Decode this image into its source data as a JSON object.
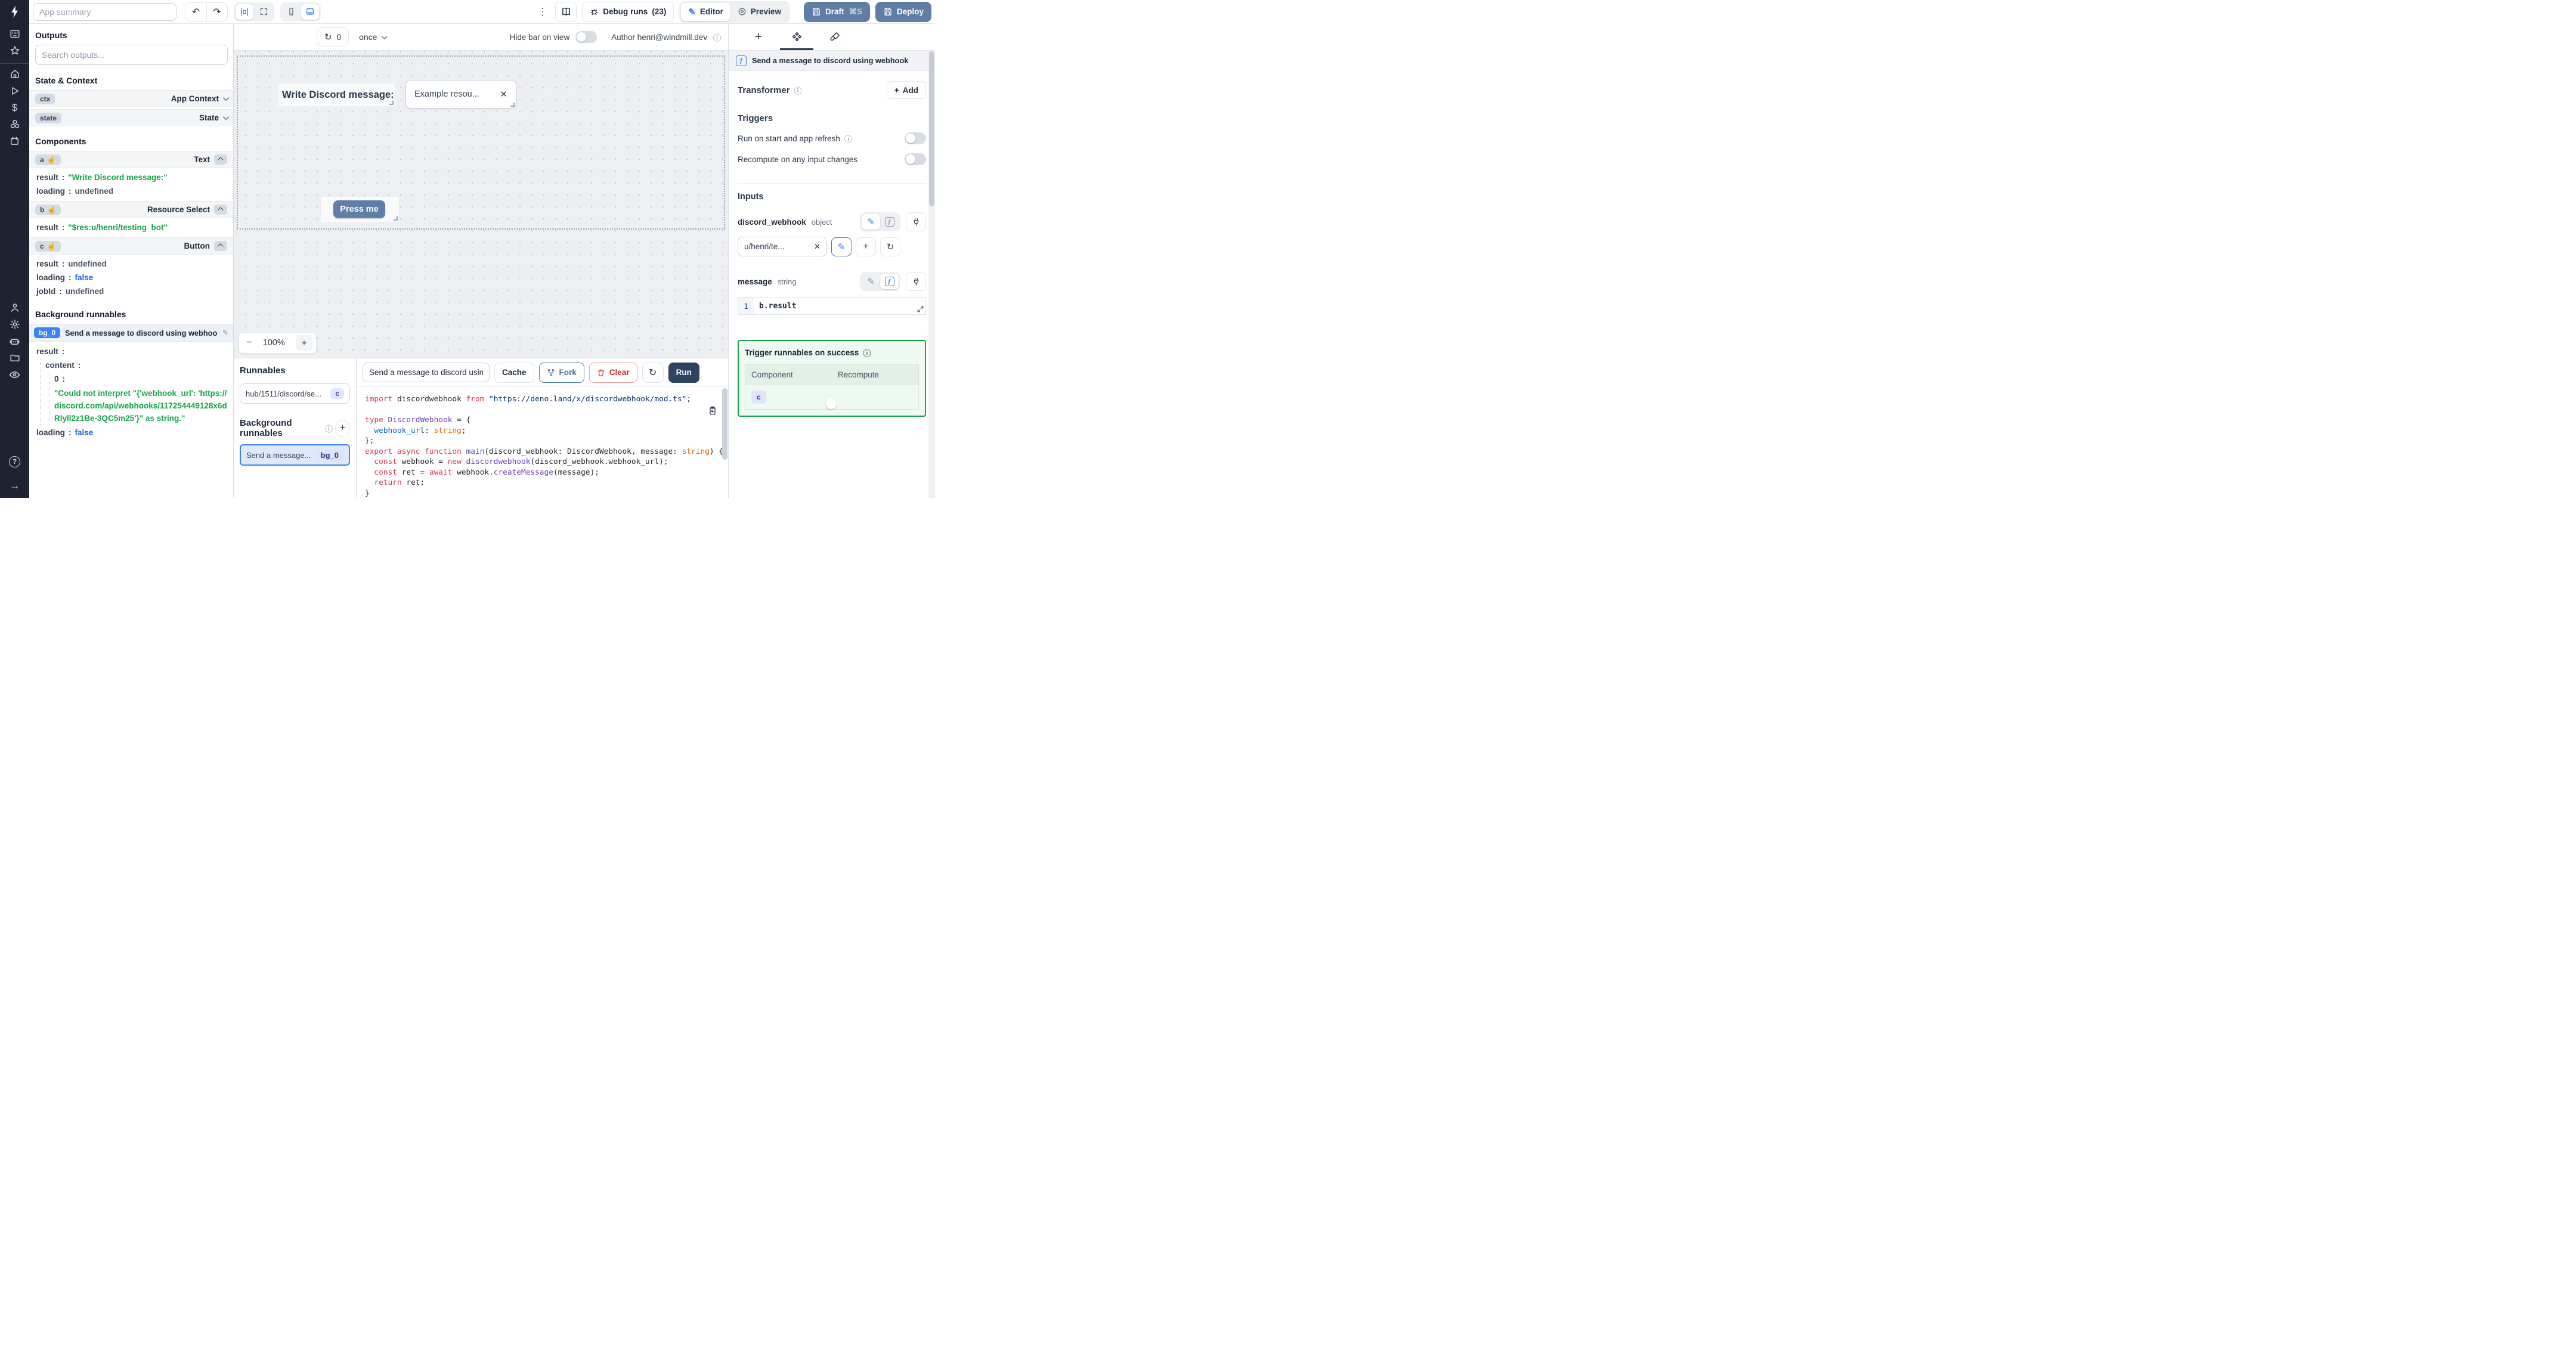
{
  "colors": {
    "accent_blue": "#3b82f6",
    "slate_button": "#5f7da5",
    "run_button": "#2e4262",
    "toggle_on": "#2f6cf0",
    "success_border": "#1d9f4e",
    "value_green": "#16a34a",
    "value_blue": "#2563eb",
    "rail_bg": "#1d2330"
  },
  "icons": {
    "undo": "↶",
    "redo": "↷",
    "kebab": "⋮",
    "refresh": "↻",
    "info": "ⓘ",
    "close": "✕",
    "plus": "+",
    "minus": "−",
    "pencil": "✎",
    "hand": "☝",
    "fn": "f",
    "question": "?",
    "arrow_right": "→",
    "dollar": "$"
  },
  "topbar": {
    "app_summary_placeholder": "App summary",
    "debug_runs_label": "Debug runs",
    "debug_runs_count": "(23)",
    "editor_label": "Editor",
    "preview_label": "Preview",
    "draft_label": "Draft",
    "draft_shortcut": "⌘S",
    "deploy_label": "Deploy"
  },
  "canvas_toolbar": {
    "refresh_count": "0",
    "frequency": "once",
    "hide_bar_label": "Hide bar on view",
    "author_label": "Author henri@windmill.dev"
  },
  "canvas": {
    "text_component": "Write Discord message:",
    "select_value": "Example resou...",
    "button_label": "Press me",
    "zoom_level": "100%"
  },
  "outputs": {
    "title": "Outputs",
    "search_placeholder": "Search outputs...",
    "sep": ":",
    "state_title": "State & Context",
    "ctx_badge": "ctx",
    "ctx_label": "App Context",
    "state_badge": "state",
    "state_label": "State",
    "components_title": "Components",
    "a_badge": "a",
    "a_type": "Text",
    "a_result_key": "result",
    "a_result_val": "\"Write Discord message:\"",
    "a_loading_key": "loading",
    "a_loading_val": "undefined",
    "b_badge": "b",
    "b_type": "Resource Select",
    "b_result_key": "result",
    "b_result_val": "\"$res:u/henri/testing_bot\"",
    "c_badge": "c",
    "c_type": "Button",
    "c_result_key": "result",
    "c_result_val": "undefined",
    "c_loading_key": "loading",
    "c_loading_val": "false",
    "c_jobid_key": "jobId",
    "c_jobid_val": "undefined",
    "bg_title": "Background runnables",
    "bg_badge": "bg_0",
    "bg_label": "Send a message to discord using webhook",
    "bg_result_key": "result",
    "bg_content_key": "content",
    "bg_index_key": "0",
    "bg_error": "\"Could not interpret \"{'webhook_url': 'https://discord.com/api/webhooks/117254449128x6dRlyll2z1Be-3QC5m25'}\" as string.\"",
    "bg_loading_key": "loading",
    "bg_loading_val": "false"
  },
  "runnables": {
    "title": "Runnables",
    "script_label": "hub/1511/discord/se...",
    "script_badge": "c",
    "bg_title": "Background runnables",
    "bg_label": "Send a message...",
    "bg_badge": "bg_0"
  },
  "editor": {
    "name_value": "Send a message to discord using",
    "cache_label": "Cache",
    "fork_label": "Fork",
    "clear_label": "Clear",
    "run_label": "Run",
    "code_lines": [
      [
        [
          "kw",
          "import "
        ],
        [
          "pl",
          "discordwebhook "
        ],
        [
          "kw",
          "from "
        ],
        [
          "st",
          "\"https://deno.land/x/discordwebhook/mod.ts\""
        ],
        [
          "pl",
          ";"
        ]
      ],
      [
        [
          "pl",
          ""
        ]
      ],
      [
        [
          "kw",
          "type "
        ],
        [
          "ty",
          "DiscordWebhook"
        ],
        [
          "pl",
          " = {"
        ]
      ],
      [
        [
          "pl",
          "  "
        ],
        [
          "pr",
          "webhook_url"
        ],
        [
          "pl",
          ": "
        ],
        [
          "or",
          "string"
        ],
        [
          "pl",
          ";"
        ]
      ],
      [
        [
          "pl",
          "};"
        ]
      ],
      [
        [
          "kw",
          "export async function "
        ],
        [
          "fn",
          "main"
        ],
        [
          "pl",
          "(discord_webhook: DiscordWebhook, message: "
        ],
        [
          "or",
          "string"
        ],
        [
          "pl",
          ") {"
        ]
      ],
      [
        [
          "pl",
          "  "
        ],
        [
          "kw",
          "const"
        ],
        [
          "pl",
          " webhook = "
        ],
        [
          "kw",
          "new"
        ],
        [
          "pl",
          " "
        ],
        [
          "ty",
          "discordwebhook"
        ],
        [
          "pl",
          "(discord_webhook.webhook_url);"
        ]
      ],
      [
        [
          "pl",
          "  "
        ],
        [
          "kw",
          "const"
        ],
        [
          "pl",
          " ret = "
        ],
        [
          "kw",
          "await"
        ],
        [
          "pl",
          " webhook."
        ],
        [
          "ty",
          "createMessage"
        ],
        [
          "pl",
          "(message);"
        ]
      ],
      [
        [
          "pl",
          "  "
        ],
        [
          "kw",
          "return"
        ],
        [
          "pl",
          " ret;"
        ]
      ],
      [
        [
          "pl",
          "}"
        ]
      ]
    ]
  },
  "right": {
    "header": "Send a message to discord using webhook",
    "transformer_label": "Transformer",
    "add_label": "Add",
    "triggers_title": "Triggers",
    "trigger1": "Run on start and app refresh",
    "trigger2": "Recompute on any input changes",
    "inputs_title": "Inputs",
    "input1_name": "discord_webhook",
    "input1_type": "object",
    "input1_value": "u/henri/te...",
    "input2_name": "message",
    "input2_type": "string",
    "input2_lineno": "1",
    "input2_expr": "b.result",
    "success_title": "Trigger runnables on success",
    "col_component": "Component",
    "col_recompute": "Recompute",
    "row_component_badge": "c"
  }
}
